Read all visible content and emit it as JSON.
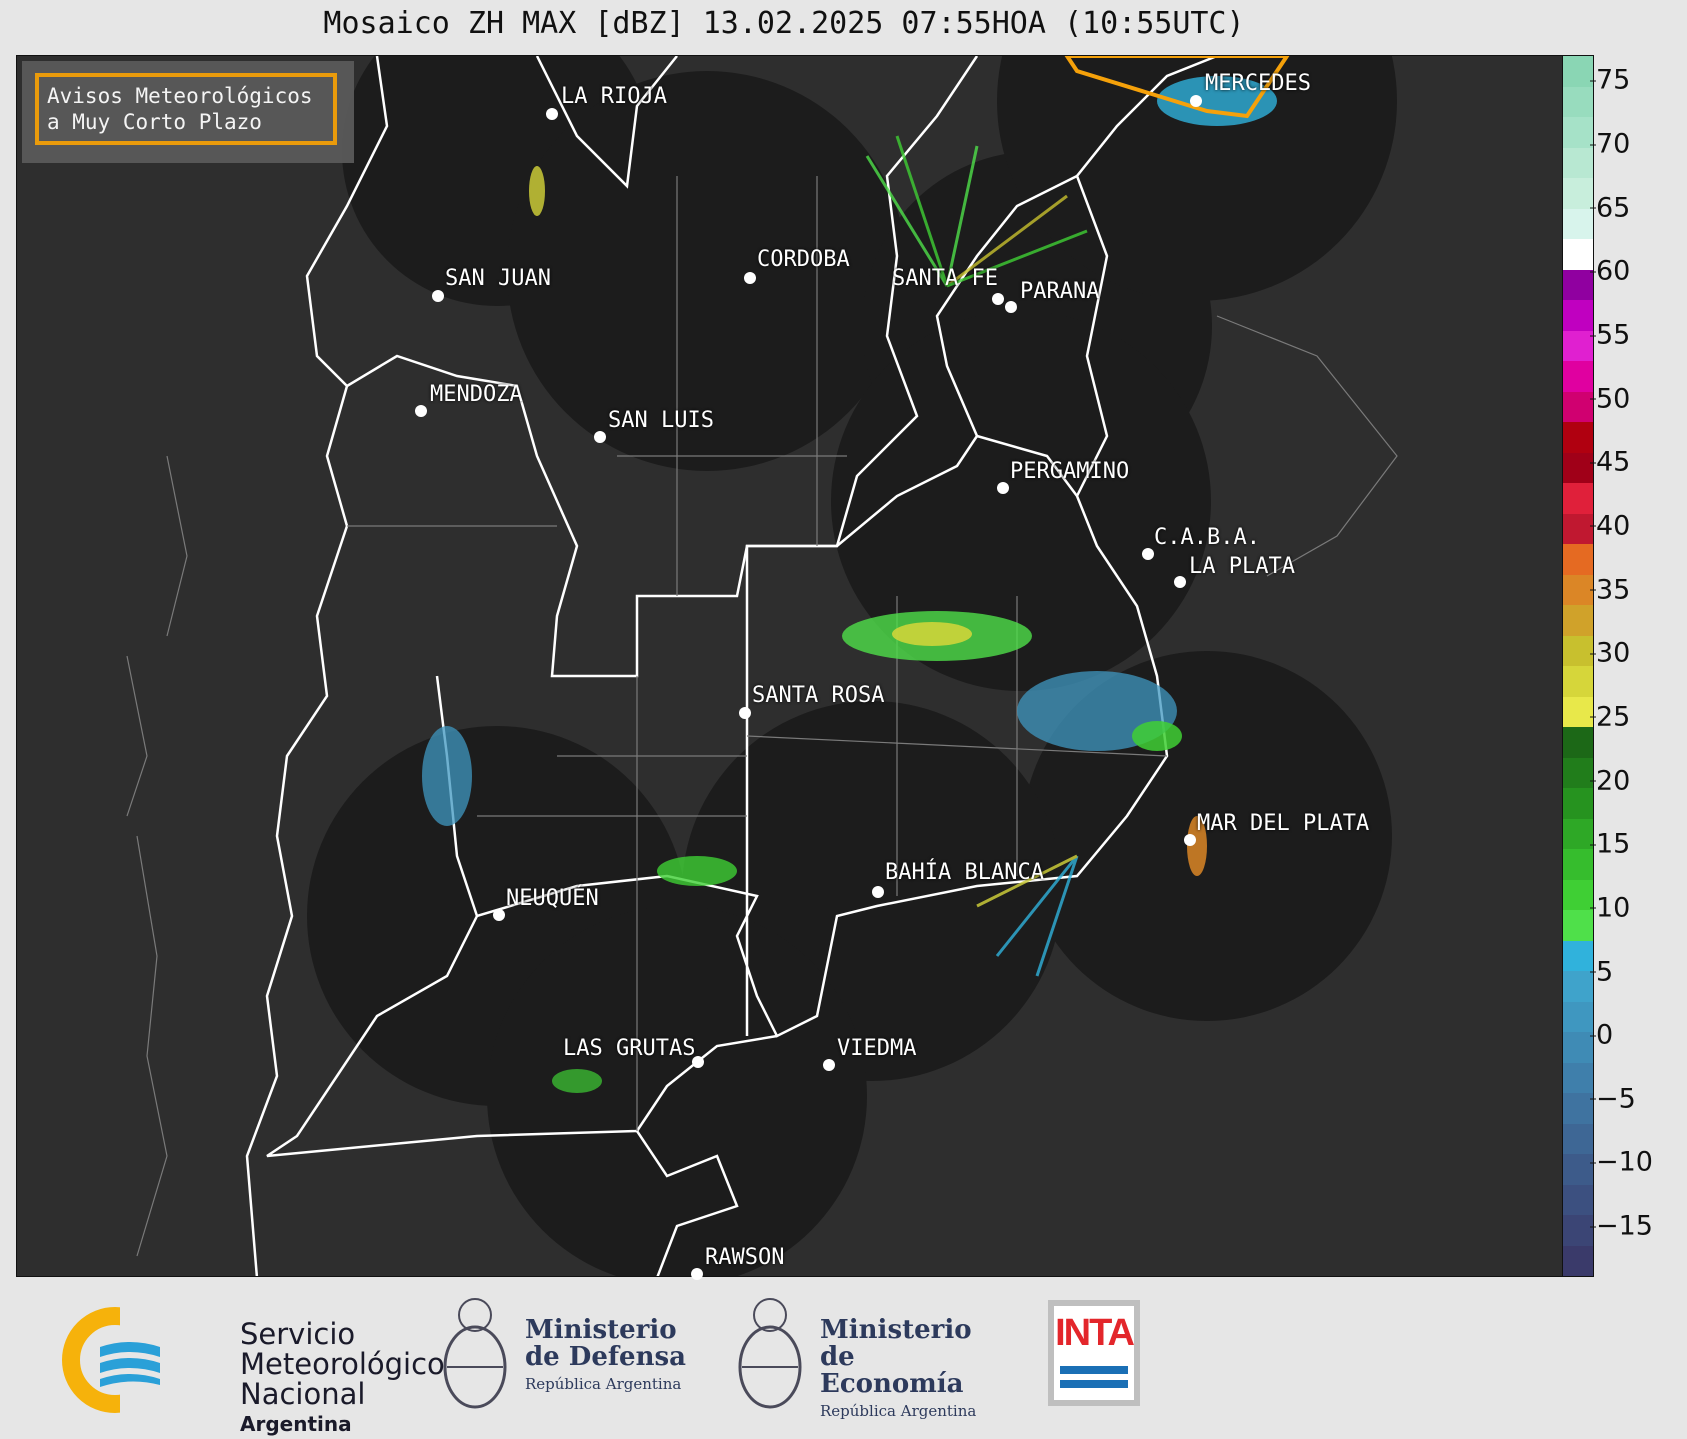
{
  "title": "Mosaico ZH MAX [dBZ] 13.02.2025 07:55HOA (10:55UTC)",
  "notice": {
    "line1": "Avisos Meteorológicos",
    "line2": "a Muy Corto Plazo",
    "border_color": "#f5a10a"
  },
  "cities": [
    {
      "name": "LA RIOJA"
    },
    {
      "name": "CORDOBA"
    },
    {
      "name": "SAN JUAN"
    },
    {
      "name": "SANTA FE"
    },
    {
      "name": "PARANA"
    },
    {
      "name": "MERCEDES"
    },
    {
      "name": "MENDOZA"
    },
    {
      "name": "SAN LUIS"
    },
    {
      "name": "PERGAMINO"
    },
    {
      "name": "C.A.B.A."
    },
    {
      "name": "LA PLATA"
    },
    {
      "name": "SANTA ROSA"
    },
    {
      "name": "MAR DEL PLATA"
    },
    {
      "name": "BAHÍA BLANCA"
    },
    {
      "name": "NEUQUÉN"
    },
    {
      "name": "LAS GRUTAS"
    },
    {
      "name": "VIEDMA"
    },
    {
      "name": "RAWSON"
    }
  ],
  "colorbar": {
    "ticks": [
      "75",
      "70",
      "65",
      "60",
      "55",
      "50",
      "45",
      "40",
      "35",
      "30",
      "25",
      "20",
      "15",
      "10",
      "5",
      "0",
      "−5",
      "−10",
      "−15"
    ],
    "colors": [
      "#3a3a6a",
      "#3b4575",
      "#3c5080",
      "#3d5b8a",
      "#3e6795",
      "#3f73a0",
      "#3f7fab",
      "#3f8bb5",
      "#3f97c0",
      "#3fa3cb",
      "#30b2dc",
      "#4fe04a",
      "#3fcf34",
      "#36bd2d",
      "#2ea826",
      "#26931f",
      "#217d1b",
      "#1c6817",
      "#e8e84a",
      "#d6d63a",
      "#c8c02e",
      "#d0a22a",
      "#db8626",
      "#e56a22",
      "#c01830",
      "#e0203a",
      "#a00018",
      "#b00010",
      "#d00070",
      "#e000a0",
      "#e020d0",
      "#c000c0",
      "#9000a0",
      "#ffffff",
      "#d8f4ec",
      "#c8eedc",
      "#b8e8d2",
      "#a6e2c8",
      "#98dcbe",
      "#8ad6b4"
    ]
  },
  "radar_cells": [
    {
      "name": "cell-la-rioja",
      "color": "#3fa3cb"
    },
    {
      "name": "cell-cordoba",
      "color": "#3fcf34"
    },
    {
      "name": "cell-santa-fe",
      "color": "#4fe04a"
    },
    {
      "name": "cell-mercedes",
      "color": "#30b2dc"
    },
    {
      "name": "cell-pergamino",
      "color": "#4fe04a"
    },
    {
      "name": "cell-mar-del-plata",
      "color": "#30b2dc"
    },
    {
      "name": "cell-neuquen",
      "color": "#3f97c0"
    },
    {
      "name": "cell-bahia-blanca",
      "color": "#3fcf34"
    },
    {
      "name": "cell-las-grutas",
      "color": "#3fcf34"
    }
  ],
  "footer": {
    "smn_line1": "Servicio",
    "smn_line2": "Meteorológico",
    "smn_line3": "Nacional",
    "smn_line4": "Argentina",
    "def_line1": "Ministerio",
    "def_line2": "de Defensa",
    "def_line3": "República Argentina",
    "eco_line1": "Ministerio",
    "eco_line2": "de Economía",
    "eco_line3": "República Argentina",
    "inta": "INTA"
  }
}
